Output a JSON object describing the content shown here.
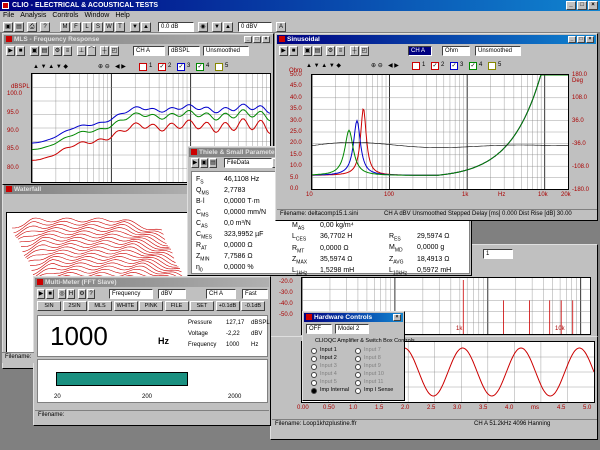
{
  "app": {
    "title": "CLIO - ELECTRICAL & ACOUSTICAL TESTS"
  },
  "menu": [
    "File",
    "Analysis",
    "Controls",
    "Window",
    "Help"
  ],
  "toolbar": {
    "gen_level": "0.0 dB",
    "input_level": "0 dBV"
  },
  "mls": {
    "title": "MLS - Frequency Response",
    "channel": "CH A",
    "unit": "dBSPL",
    "smoothing": "Unsmoothed",
    "ylabel": "dBSPL",
    "yticks": [
      "100.0",
      "95.0",
      "90.0",
      "85.0",
      "80.0",
      "75.0",
      "70.0",
      "65.0"
    ],
    "checks": [
      "1",
      "2",
      "3",
      "4",
      "5"
    ]
  },
  "sinusoidal": {
    "title": "Sinusoidal",
    "channel": "CH A",
    "unit": "Ohm",
    "smoothing": "Unsmoothed",
    "ylabel": "Ohm",
    "ylabel_right": "Deg",
    "yticks": [
      "50.0",
      "45.0",
      "40.0",
      "35.0",
      "30.0",
      "25.0",
      "20.0",
      "15.0",
      "10.0",
      "5.0",
      "0.0"
    ],
    "yticks_right": [
      "180.0",
      "108.0",
      "36.0",
      "-36.0",
      "-108.0",
      "-180.0"
    ],
    "xticks": [
      "10",
      "100",
      "1k",
      "Hz",
      "10k",
      "20k"
    ],
    "status": "Filename: deltacomp15.1.sini",
    "status_right": "CH A   dBV   Unsmoothed   Stepped   Delay [ms] 0.000   Dist Rise [dB] 30.00",
    "checks": [
      "1",
      "2",
      "3",
      "4",
      "5"
    ]
  },
  "ts": {
    "title": "Thiele & Small Parameters",
    "source": "FileData",
    "left": [
      [
        "F",
        "S",
        "46,1108 Hz"
      ],
      [
        "Q",
        "MS",
        "2,7783"
      ],
      [
        "B·l",
        "",
        "0,0000 T·m"
      ],
      [
        "C",
        "MS",
        "0,0000 mm/N"
      ],
      [
        "C",
        "AS",
        "0,0 m³/N"
      ],
      [
        "C",
        "MES",
        "323,9952 µF"
      ],
      [
        "R",
        "AT",
        "0,0000 Ω"
      ],
      [
        "Z",
        "MIN",
        "7,7586 Ω"
      ],
      [
        "η",
        "0",
        "0,0000 %"
      ]
    ],
    "right": [
      [
        "M",
        "AS",
        "0,00 kg/m⁴"
      ],
      [
        "L",
        "CES",
        "36,7702 H"
      ],
      [
        "R",
        "MT",
        "0,0000 Ω"
      ],
      [
        "Z",
        "MAX",
        "35,5974 Ω"
      ],
      [
        "L",
        "1kHz",
        "1,5298 mH"
      ]
    ],
    "right2": [
      [
        "R",
        "ES",
        "29,5974 Ω"
      ],
      [
        "M",
        "MD",
        "0,0000 g"
      ],
      [
        "Z",
        "AVG",
        "18,4913 Ω"
      ],
      [
        "L",
        "10kHz",
        "0,5972 mH"
      ]
    ]
  },
  "waterfall": {
    "title": "Waterfall",
    "status": "Filename:"
  },
  "multimeter": {
    "title": "Multi-Meter (FFT Slave)",
    "mode": "Frequency",
    "unit": "dBV",
    "channel": "CH A",
    "speed": "Fast",
    "buttons": [
      "SIN",
      "2SIN",
      "MLS",
      "WHITE",
      "PINK",
      "FILE",
      "SET",
      "+0.1dB",
      "-0.1dB"
    ],
    "value": "1000",
    "value_unit": "Hz",
    "readings": [
      [
        "Pressure",
        "127,17",
        "dBSPL"
      ],
      [
        "Voltage",
        "-2,22",
        "dBV"
      ],
      [
        "Frequency",
        "1000",
        "Hz"
      ]
    ],
    "bar_fraction": 0.62,
    "bar_ticks": [
      "20",
      "200",
      "2000"
    ],
    "status": "Filename:"
  },
  "fft": {
    "xticks": [
      "1k",
      "10k"
    ],
    "yticks": [
      "-20.0",
      "-30.0",
      "-40.0",
      "-50.0"
    ],
    "box_value": "1"
  },
  "scope": {
    "xticks": [
      "0.00",
      "0.50",
      "1.0",
      "1.5",
      "2.0",
      "2.5",
      "3.0",
      "3.5",
      "4.0",
      "ms",
      "4.5",
      "5.0"
    ],
    "status": "Filename: Loop1khzplustine.ffr",
    "status_right": "CH A   51.2kHz   4096   Hanning"
  },
  "hardware": {
    "title": "Hardware Controls",
    "state": "OFF",
    "model": "Model 2",
    "group": "CLIOQC Amplifier & Switch Box Controls",
    "inputs_left": [
      "Input 1",
      "Input 2",
      "Input 3",
      "Input 4",
      "Input 5",
      "Imp Internal"
    ],
    "inputs_right": [
      "Input 7",
      "Input 8",
      "Input 9",
      "Input 10",
      "Input 11",
      "Imp I Sense"
    ]
  },
  "status_left": "Filename:"
}
